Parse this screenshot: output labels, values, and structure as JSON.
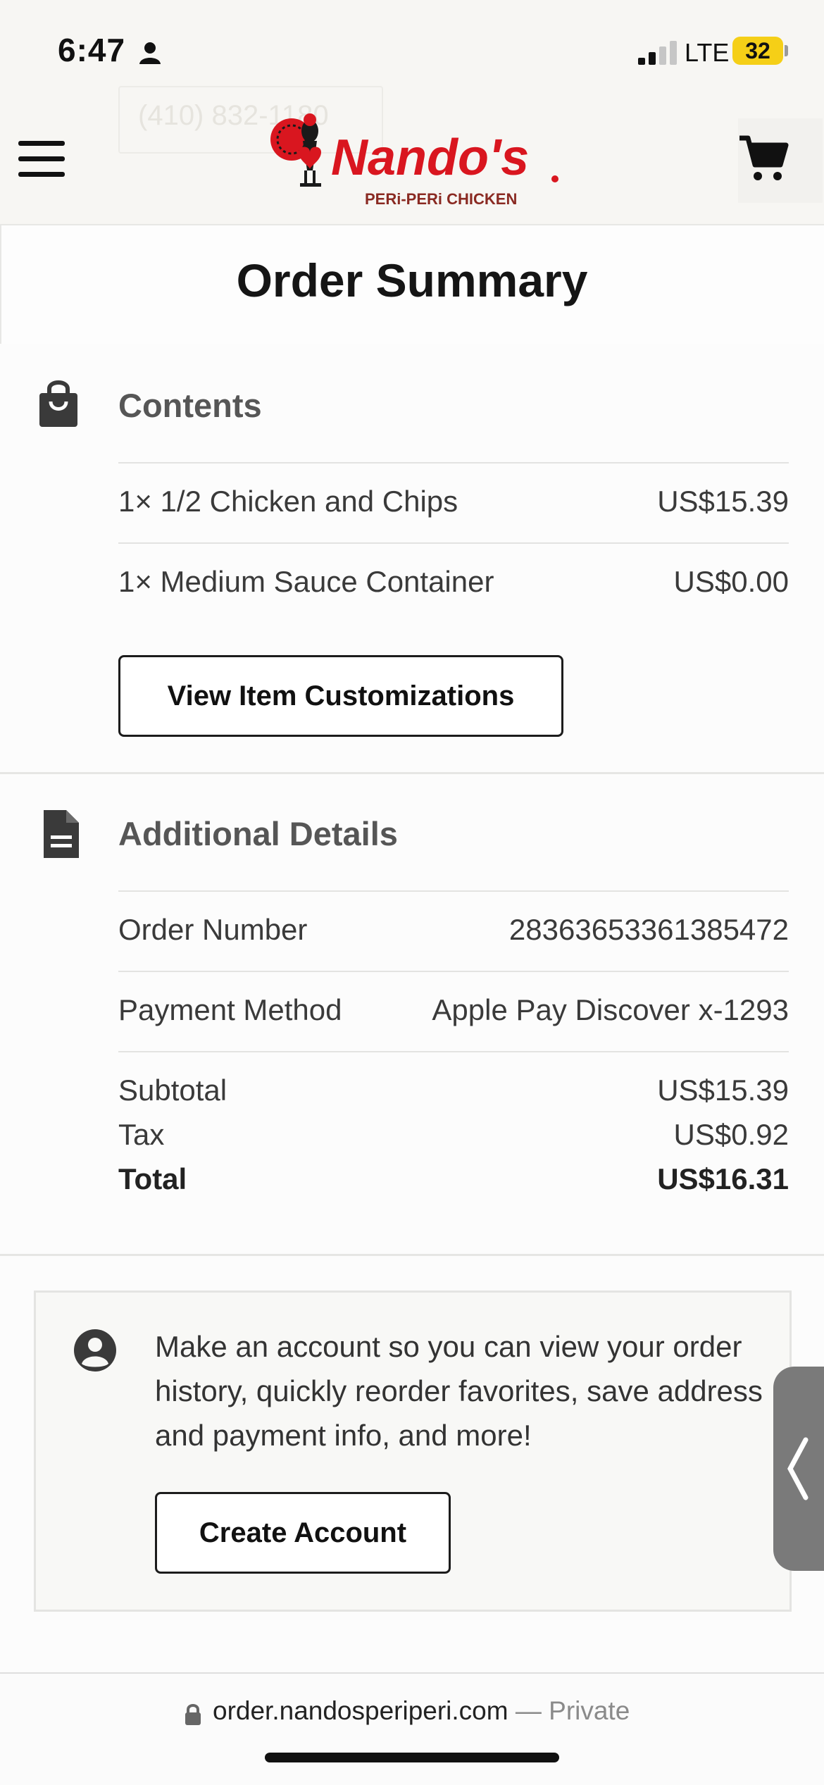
{
  "status_bar": {
    "time": "6:47",
    "network": "LTE",
    "battery": "32",
    "icons": [
      "person-icon",
      "signal-icon",
      "battery-icon"
    ]
  },
  "header": {
    "ghost_phone": "(410) 832-1180",
    "logo_name": "Nando's",
    "logo_tagline": "PERi-PERi CHICKEN",
    "icons": [
      "menu-icon",
      "cart-icon"
    ],
    "brand_color": "#d9161f"
  },
  "page": {
    "title": "Order Summary"
  },
  "contents": {
    "title": "Contents",
    "items": [
      {
        "name": "1× 1/2 Chicken and Chips",
        "price": "US$15.39"
      },
      {
        "name": "1× Medium Sauce Container",
        "price": "US$0.00"
      }
    ],
    "customizations_button": "View Item Customizations"
  },
  "additional": {
    "title": "Additional Details",
    "order_number_label": "Order Number",
    "order_number": "28363653361385472",
    "payment_label": "Payment Method",
    "payment_value": "Apple Pay Discover x-1293",
    "subtotal_label": "Subtotal",
    "subtotal": "US$15.39",
    "tax_label": "Tax",
    "tax": "US$0.92",
    "total_label": "Total",
    "total": "US$16.31"
  },
  "account": {
    "message": "Make an account so you can view your order history, quickly reorder favorites, save address and payment info, and more!",
    "button": "Create Account"
  },
  "browser": {
    "url": "order.nandosperiperi.com",
    "privacy": "— Private"
  }
}
